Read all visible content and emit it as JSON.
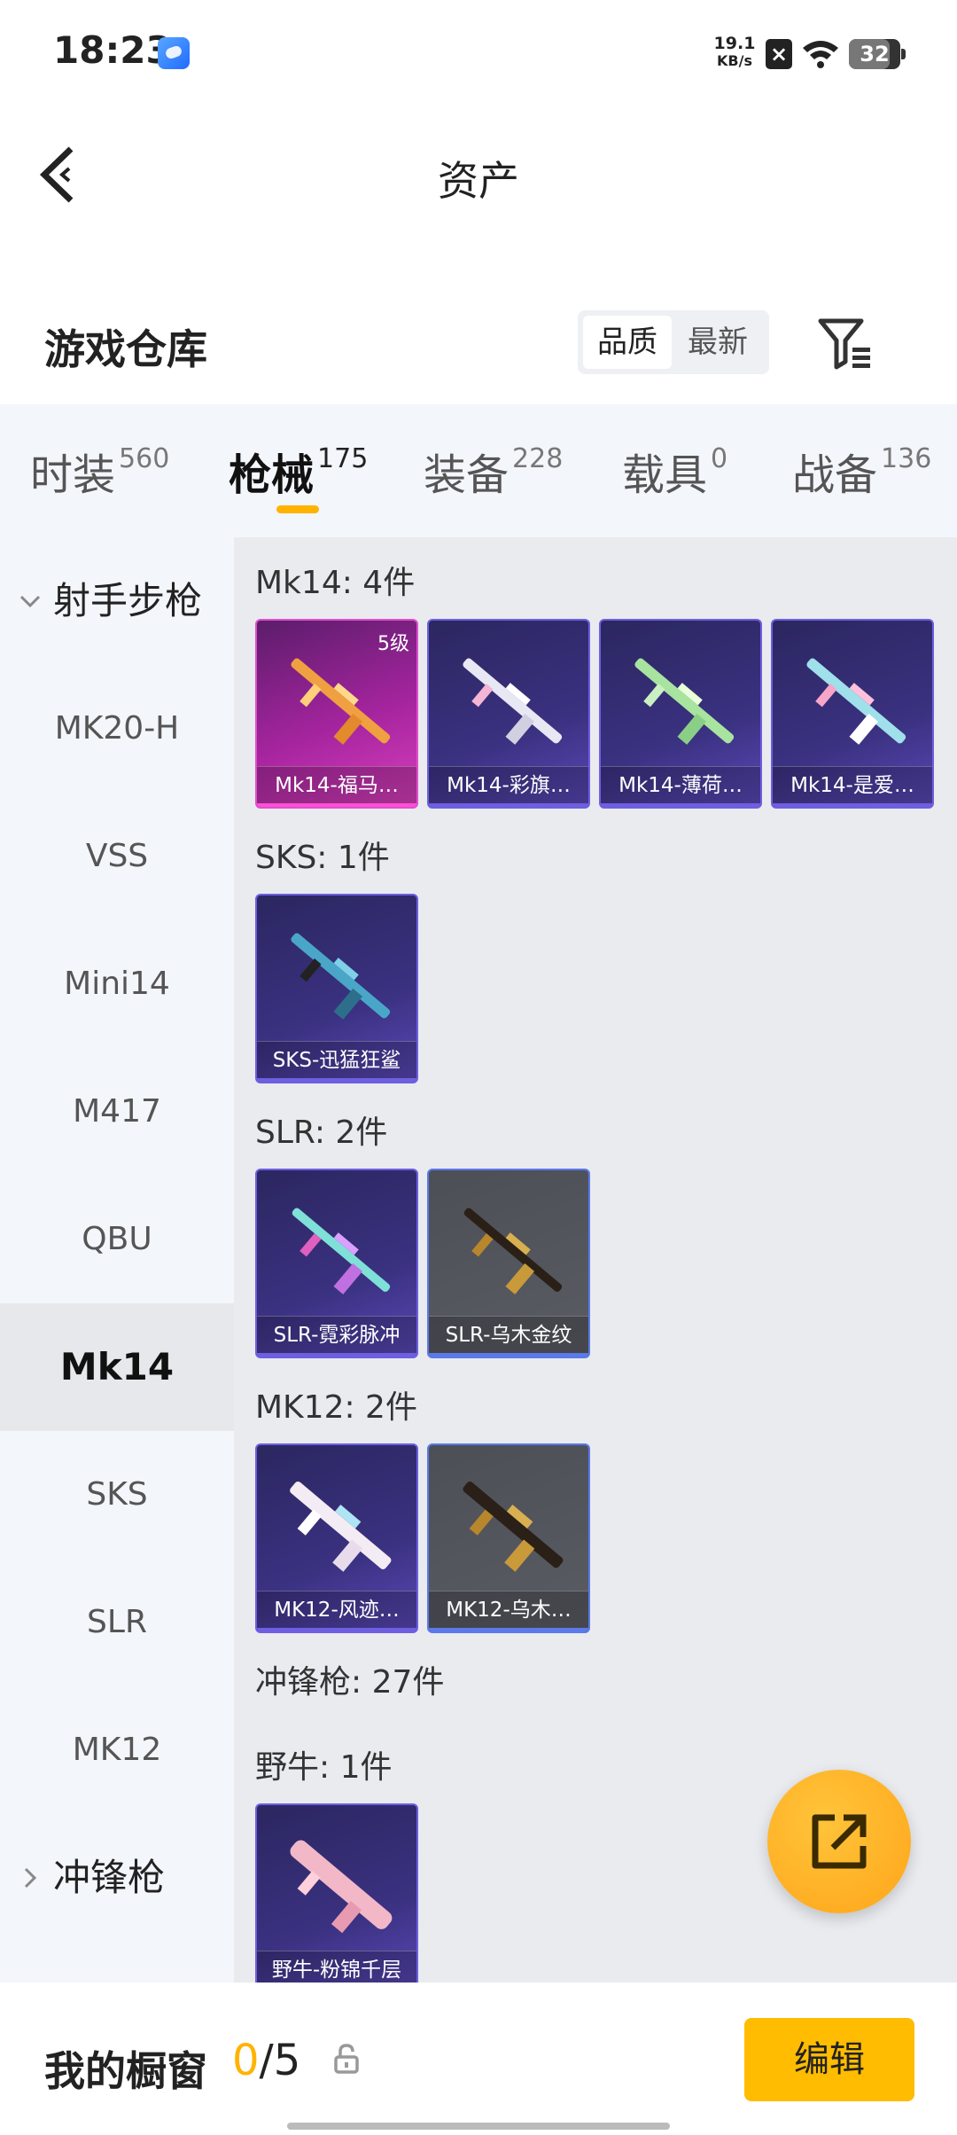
{
  "status_bar": {
    "time": "18:23",
    "net_speed_value": "19.1",
    "net_speed_unit": "KB/s",
    "battery": "32"
  },
  "header": {
    "title": "资产"
  },
  "warehouse": {
    "title": "游戏仓库",
    "sort_options": [
      "品质",
      "最新"
    ],
    "selected_sort": "品质"
  },
  "tabs": [
    {
      "label": "时装",
      "count": "560"
    },
    {
      "label": "枪械",
      "count": "175",
      "active": true
    },
    {
      "label": "装备",
      "count": "228"
    },
    {
      "label": "载具",
      "count": "0"
    },
    {
      "label": "战备",
      "count": "136"
    }
  ],
  "sidebar": {
    "group_open": "射手步枪",
    "items": [
      "MK20-H",
      "VSS",
      "Mini14",
      "M417",
      "QBU",
      "Mk14",
      "SKS",
      "SLR",
      "MK12"
    ],
    "active_item": "Mk14",
    "group_collapsed": "冲锋枪"
  },
  "sections": [
    {
      "title": "Mk14: 4件",
      "cards": [
        {
          "name": "Mk14-福马…",
          "level": "5级",
          "rarity": "pink"
        },
        {
          "name": "Mk14-彩旗…",
          "rarity": "purple"
        },
        {
          "name": "Mk14-薄荷…",
          "rarity": "purple"
        },
        {
          "name": "Mk14-是爱…",
          "rarity": "purple"
        }
      ]
    },
    {
      "title": "SKS: 1件",
      "cards": [
        {
          "name": "SKS-迅猛狂鲨",
          "rarity": "purple"
        }
      ]
    },
    {
      "title": "SLR: 2件",
      "cards": [
        {
          "name": "SLR-霓彩脉冲",
          "rarity": "purple"
        },
        {
          "name": "SLR-乌木金纹",
          "rarity": "grey"
        }
      ]
    },
    {
      "title": "MK12: 2件",
      "cards": [
        {
          "name": "MK12-风迹…",
          "rarity": "purple"
        },
        {
          "name": "MK12-乌木…",
          "rarity": "grey"
        }
      ]
    },
    {
      "title": "冲锋枪: 27件",
      "cards": []
    },
    {
      "title": "野牛: 1件",
      "cards": [
        {
          "name": "野牛-粉锦千层",
          "rarity": "purple"
        }
      ]
    }
  ],
  "bottom": {
    "showcase_label": "我的橱窗",
    "showcase_current": "0",
    "showcase_total": "/5",
    "edit_label": "编辑"
  },
  "colors": {
    "accent": "#ffbc00",
    "pink_card": "#d93fbd",
    "purple_card": "#3a3180",
    "grey_card": "#5a5c64"
  },
  "icons": {
    "back": "chevron-left-icon",
    "filter": "filter-icon",
    "share": "share-external-icon",
    "lock": "lock-icon"
  }
}
